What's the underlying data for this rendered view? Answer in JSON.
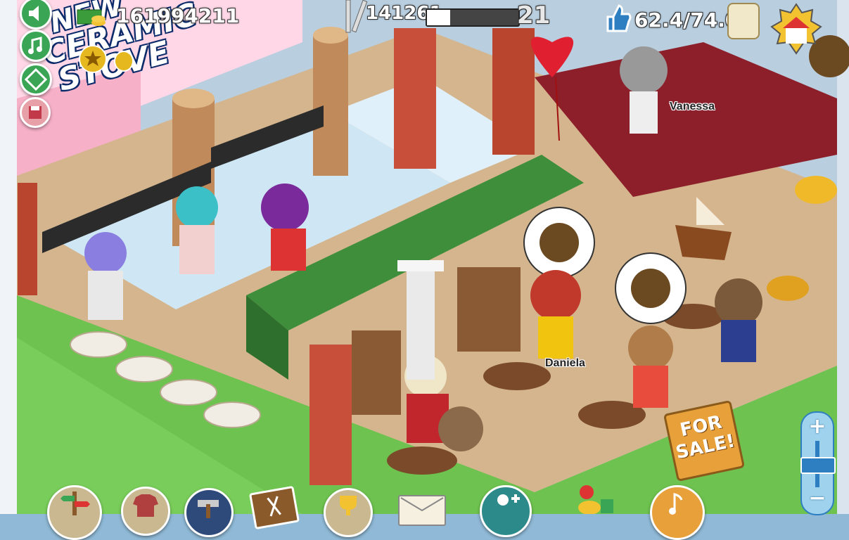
{
  "hud": {
    "coins": "161994211",
    "food_count": "141261",
    "level": "21",
    "rating": "62.4/74.0",
    "xp_progress": 0.25
  },
  "sign": {
    "text_line1": "NEW",
    "text_line2": "CERAMIC",
    "text_line3": "STOVE"
  },
  "for_sale_sign": {
    "line1": "FOR",
    "line2": "SALE!"
  },
  "characters": {
    "names": [
      "Vanessa",
      "Daniela"
    ]
  },
  "left_buttons": [
    "sound-icon",
    "music-icon",
    "rotate-icon",
    "save-icon"
  ],
  "bottom_toolbar": [
    "map-icon",
    "shirt-icon",
    "hammer-icon",
    "menu-icon",
    "trophy-icon",
    "mail-icon",
    "add-friend-icon",
    "shop-icon",
    "music-note-icon"
  ],
  "zoom": {
    "plus": "+",
    "minus": "−",
    "level": 0.5
  },
  "colors": {
    "floor_green": "#6ec24f",
    "wall_red": "#c8503a",
    "hud_blue": "#2d7fc1",
    "button_green": "#3aa655"
  }
}
